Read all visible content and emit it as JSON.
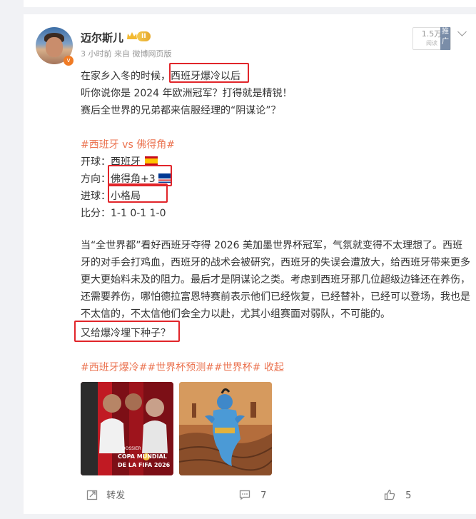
{
  "post": {
    "username": "迈尔斯儿",
    "level": "II",
    "meta": "3 小时前  来自 微博网页版",
    "views_count": "1.5万",
    "views_label": "阅读",
    "promote_label": "推广",
    "lines": {
      "l1_prefix": "在家乡入冬的时候，",
      "l1_highlight": "西班牙爆冷以后",
      "l2": "听你说你是 2024 年欧洲冠军？打得就是精锐！",
      "l3": "赛后全世界的兄弟都来信服经理的“阴谋论”？",
      "topic": "#西班牙 vs 佛得角#",
      "open_label": "开球：西班牙",
      "direction_label": "方向：",
      "direction_value": "佛得角+3",
      "goals_label": "进球：",
      "goals_value": "小格局",
      "score": "比分：1-1 0-1 1-0"
    },
    "paragraph": "当“全世界都”看好西班牙夺得 2026 美加墨世界杯冠军，气氛就变得不太理想了。西班牙的对手会打鸡血，西班牙的战术会被研究，西班牙的失误会遭放大，给西班牙带来更多更大更始料未及的阻力。最后才是阴谋论之类。考虑到西班牙那几位超级边锋还在养伤，还需要养伤，哪怕德拉富恩特赛前表示他们已经恢复，已经替补，已经可以登场，我也是不太信的，不太信他们会全力以赴，尤其小组赛面对弱队，不可能的。",
    "closing": "又给爆冷埋下种子？",
    "tags": "#西班牙爆冷##世界杯预测##世界杯#",
    "collapse": "收起",
    "image1_text": {
      "line1": "DOSSIER",
      "line2": "COPA MUNDIAL",
      "line3": "DE LA FIFA 2026"
    },
    "footer": {
      "forward": "转发",
      "comments": "7",
      "likes": "5"
    }
  },
  "colors": {
    "highlight_box": "#e1252a",
    "topic": "#eb7350",
    "text": "#333333",
    "muted": "#999999"
  }
}
